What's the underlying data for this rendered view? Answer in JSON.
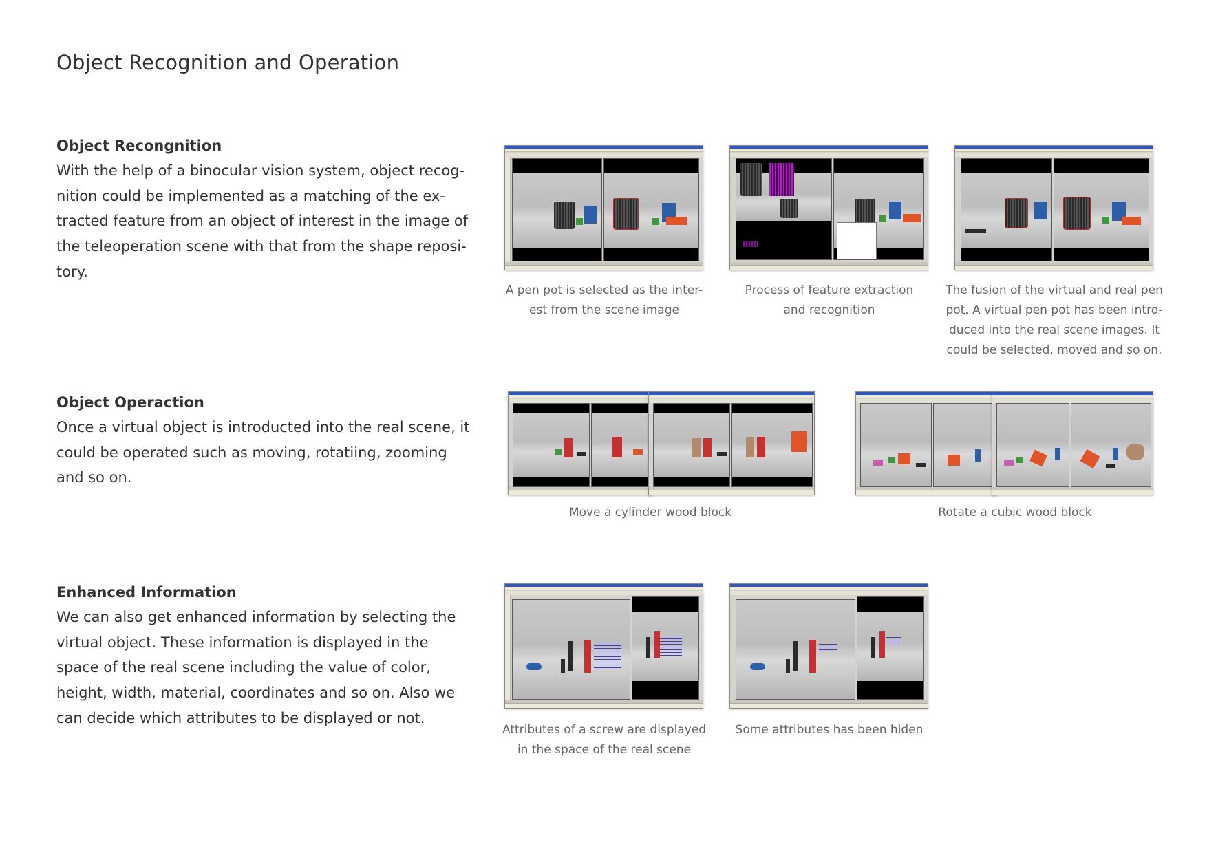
{
  "page": {
    "title": "Object Recognition and Operation"
  },
  "sections": {
    "recognition": {
      "heading": "Object Recongnition",
      "lines": [
        "With the help of a binocular vision system, object recog-",
        "nition could be implemented as a matching of the ex-",
        "tracted feature from an object of interest in the image of",
        "the teleoperation scene with that from the shape reposi-",
        "tory."
      ],
      "captions": [
        [
          "A pen pot is selected as the inter-",
          "est from the scene image"
        ],
        [
          "Process of feature extraction",
          "and recognition"
        ],
        [
          "The fusion of the virtual and real pen",
          "pot. A virtual pen pot has been intro-",
          "duced into the real scene images. It",
          "could be selected, moved and so on."
        ]
      ]
    },
    "operation": {
      "heading": "Object Operaction",
      "lines": [
        "Once a virtual object is introducted into the real scene, it",
        "could be operated such as moving, rotatiing, zooming",
        "and so on."
      ],
      "captions": [
        [
          "Move a cylinder wood block"
        ],
        [
          "Rotate a cubic wood block"
        ]
      ]
    },
    "enhanced": {
      "heading": "Enhanced Information",
      "lines": [
        "We can also get enhanced information by selecting the",
        "virtual object. These information is displayed in the",
        "space of the real scene including the value of color,",
        "height, width, material, coordinates and so on. Also we",
        "can decide which attributes to be displayed or not."
      ],
      "captions": [
        [
          "Attributes of a screw are displayed",
          "in the space of the real scene"
        ],
        [
          "Some attributes has been hiden"
        ]
      ]
    }
  }
}
